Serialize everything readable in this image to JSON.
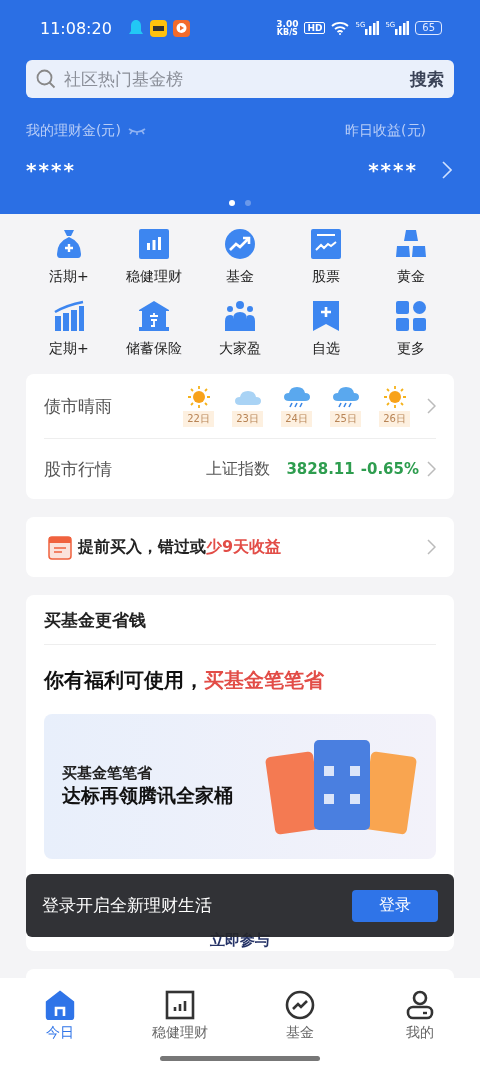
{
  "status_bar": {
    "time": "11:08:20",
    "net_speed": "3.00",
    "net_unit": "KB/S",
    "hd": "HD",
    "signals": [
      "5G",
      "5G"
    ],
    "battery": "65"
  },
  "search": {
    "placeholder": "社区热门基金榜",
    "button": "搜索"
  },
  "assets": {
    "total_label": "我的理财金(元)",
    "total_value": "****",
    "yesterday_label": "昨日收益(元)",
    "yesterday_value": "****"
  },
  "carousel": [
    {
      "selected": true
    },
    {
      "selected": false
    }
  ],
  "shortcuts": [
    {
      "label": "活期+",
      "kind": "bag"
    },
    {
      "label": "稳健理财",
      "kind": "bars"
    },
    {
      "label": "基金",
      "kind": "trend"
    },
    {
      "label": "股票",
      "kind": "board"
    },
    {
      "label": "黄金",
      "kind": "gold"
    },
    {
      "label": "定期+",
      "kind": "growth"
    },
    {
      "label": "储蓄保险",
      "kind": "bank"
    },
    {
      "label": "大家盈",
      "kind": "people"
    },
    {
      "label": "自选",
      "kind": "bookmark"
    },
    {
      "label": "更多",
      "kind": "grid"
    }
  ],
  "bond_weather": {
    "label": "债市晴雨",
    "days": [
      {
        "day": "22日",
        "kind": "sunny"
      },
      {
        "day": "23日",
        "kind": "cloudy"
      },
      {
        "day": "24日",
        "kind": "rain"
      },
      {
        "day": "25日",
        "kind": "rain"
      },
      {
        "day": "26日",
        "kind": "sunny"
      }
    ]
  },
  "stock_market": {
    "label": "股市行情",
    "index_name": "上证指数",
    "value": "3828.11",
    "change": "-0.65%",
    "color": "#2e9d4f"
  },
  "notice": {
    "text": "提前买入，错过或",
    "highlight": "少9天收益"
  },
  "promo": {
    "title": "买基金更省钱",
    "headline": "你有福利可使用，",
    "headline_highlight": "买基金笔笔省",
    "banner_line1": "买基金笔笔省",
    "banner_line2": "达标再领腾讯全家桶",
    "cta": "立即参与"
  },
  "toast": {
    "text": "登录开启全新理财生活",
    "button": "登录"
  },
  "tabs": [
    {
      "label": "今日",
      "kind": "home",
      "selected": true
    },
    {
      "label": "稳健理财",
      "kind": "chart",
      "selected": false
    },
    {
      "label": "基金",
      "kind": "trend",
      "selected": false
    },
    {
      "label": "我的",
      "kind": "user",
      "selected": false
    }
  ]
}
